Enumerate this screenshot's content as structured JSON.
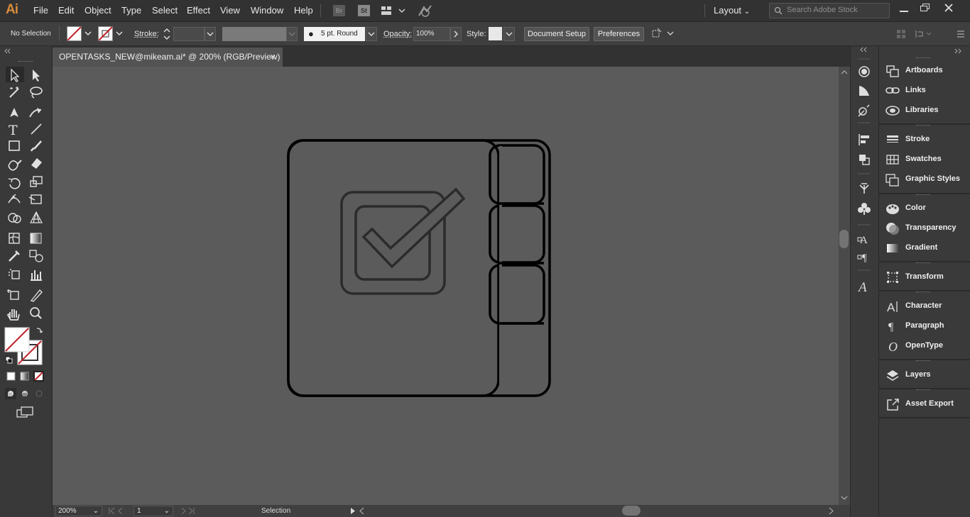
{
  "app": {
    "logo": "Ai"
  },
  "menu": [
    "File",
    "Edit",
    "Object",
    "Type",
    "Select",
    "Effect",
    "View",
    "Window",
    "Help"
  ],
  "menubar": {
    "bridge_label": "Br",
    "stock_label": "St",
    "workspace": "Layout",
    "search_placeholder": "Search Adobe Stock"
  },
  "control": {
    "selection_status": "No Selection",
    "stroke_label": "Stroke:",
    "brush_label": "5 pt. Round",
    "opacity_label": "Opacity:",
    "opacity_value": "100%",
    "style_label": "Style:",
    "doc_setup": "Document Setup",
    "preferences": "Preferences"
  },
  "tab": {
    "title": "OPENTASKS_NEW@mikeam.ai* @ 200% (RGB/Preview)",
    "close": "×"
  },
  "status": {
    "zoom": "200%",
    "artboard": "1",
    "tool": "Selection"
  },
  "panels": [
    {
      "label": "Artboards",
      "icon": "artboards-icon"
    },
    {
      "label": "Links",
      "icon": "links-icon"
    },
    {
      "label": "Libraries",
      "icon": "libraries-icon"
    },
    {
      "label": "Stroke",
      "icon": "stroke-icon"
    },
    {
      "label": "Swatches",
      "icon": "swatches-icon"
    },
    {
      "label": "Graphic Styles",
      "icon": "graphic-styles-icon"
    },
    {
      "label": "Color",
      "icon": "color-icon"
    },
    {
      "label": "Transparency",
      "icon": "transparency-icon"
    },
    {
      "label": "Gradient",
      "icon": "gradient-icon"
    },
    {
      "label": "Transform",
      "icon": "transform-icon"
    },
    {
      "label": "Character",
      "icon": "character-icon"
    },
    {
      "label": "Paragraph",
      "icon": "paragraph-icon"
    },
    {
      "label": "OpenType",
      "icon": "opentype-icon"
    },
    {
      "label": "Layers",
      "icon": "layers-icon"
    },
    {
      "label": "Asset Export",
      "icon": "asset-export-icon"
    }
  ],
  "colors": {
    "accent": "#d98b3a",
    "artwork_stroke": "#000000",
    "checkbox_stroke": "#2b2b2b"
  }
}
